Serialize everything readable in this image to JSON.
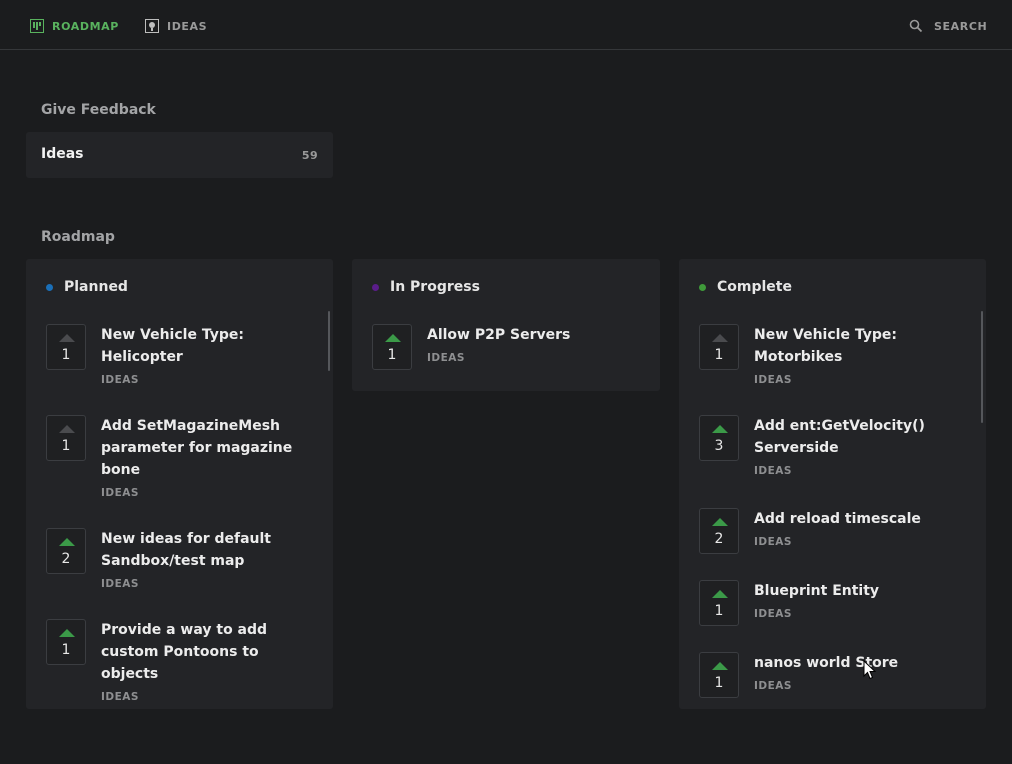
{
  "nav": {
    "roadmap_label": "ROADMAP",
    "ideas_label": "IDEAS",
    "search_label": "SEARCH",
    "active_color": "#59b25e"
  },
  "feedback": {
    "title": "Give Feedback",
    "board": {
      "name": "Ideas",
      "count": "59"
    }
  },
  "roadmap": {
    "title": "Roadmap",
    "columns": [
      {
        "name": "Planned",
        "color": "#1a6fb8",
        "posts": [
          {
            "votes": "1",
            "voted": false,
            "title": "New Vehicle Type: Helicopter",
            "tag": "IDEAS"
          },
          {
            "votes": "1",
            "voted": false,
            "title": "Add SetMagazineMesh parameter for magazine bone",
            "tag": "IDEAS"
          },
          {
            "votes": "2",
            "voted": true,
            "title": "New ideas for default Sandbox/test map",
            "tag": "IDEAS"
          },
          {
            "votes": "1",
            "voted": true,
            "title": "Provide a way to add custom Pontoons to objects",
            "tag": "IDEAS"
          }
        ]
      },
      {
        "name": "In Progress",
        "color": "#5a1d8a",
        "posts": [
          {
            "votes": "1",
            "voted": true,
            "title": "Allow P2P Servers",
            "tag": "IDEAS"
          }
        ]
      },
      {
        "name": "Complete",
        "color": "#3f9a3a",
        "posts": [
          {
            "votes": "1",
            "voted": false,
            "title": "New Vehicle Type: Motorbikes",
            "tag": "IDEAS"
          },
          {
            "votes": "3",
            "voted": true,
            "title": "Add ent:GetVelocity() Serverside",
            "tag": "IDEAS"
          },
          {
            "votes": "2",
            "voted": true,
            "title": "Add reload timescale",
            "tag": "IDEAS"
          },
          {
            "votes": "1",
            "voted": true,
            "title": "Blueprint Entity",
            "tag": "IDEAS"
          },
          {
            "votes": "1",
            "voted": true,
            "title": "nanos world Store",
            "tag": "IDEAS"
          }
        ]
      }
    ]
  }
}
